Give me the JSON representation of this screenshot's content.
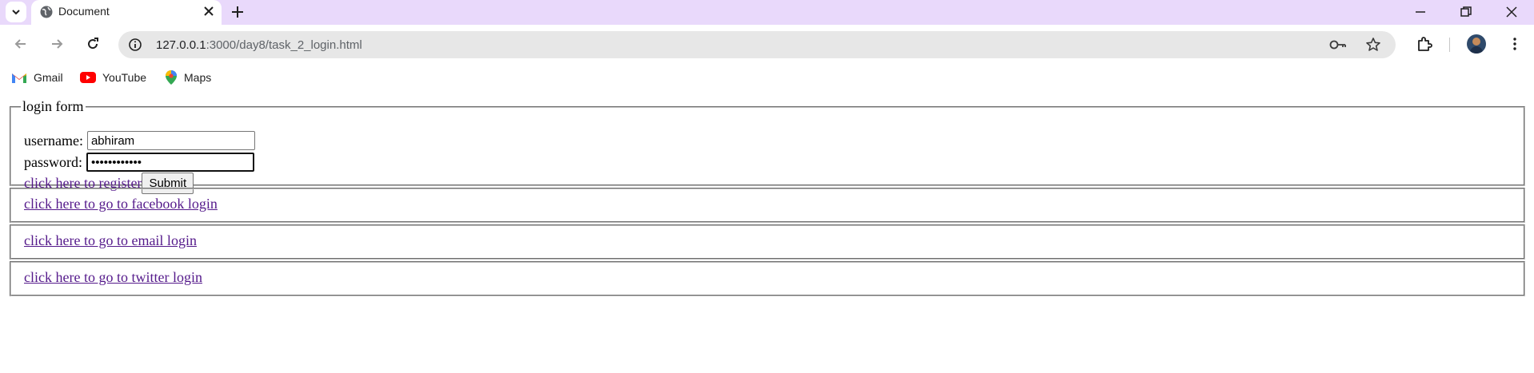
{
  "browser": {
    "tab_title": "Document",
    "url_host": "127.0.0.1",
    "url_rest": ":3000/day8/task_2_login.html",
    "bookmarks": [
      {
        "label": "Gmail",
        "icon": "gmail-icon"
      },
      {
        "label": "YouTube",
        "icon": "youtube-icon"
      },
      {
        "label": "Maps",
        "icon": "maps-icon"
      }
    ]
  },
  "login_form": {
    "legend": "login form",
    "username_label": "username:",
    "username_value": "abhiram",
    "password_label": "password:",
    "password_value": "••••••••••••",
    "register_link": "click here to register",
    "submit_label": "Submit"
  },
  "links": {
    "facebook": "click here to go to facebook login",
    "email": "click here to go to email login",
    "twitter": "click here to go to twitter login"
  },
  "colors": {
    "tabstrip": "#e9d9fb",
    "link_visited": "#551a8b",
    "omnibox": "#e7e7e7"
  }
}
